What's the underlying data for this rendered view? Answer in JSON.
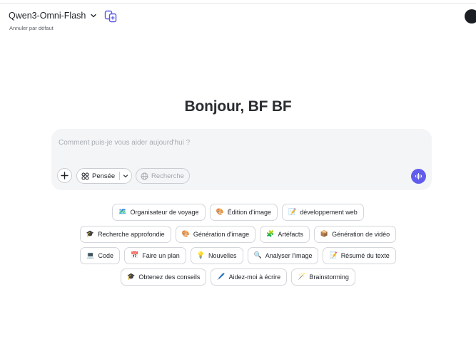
{
  "header": {
    "model_name": "Qwen3-Omni-Flash",
    "reset_label": "Annuler par défaut"
  },
  "greeting": "Bonjour, BF BF",
  "composer": {
    "placeholder": "Comment puis-je vous aider aujourd'hui ?",
    "think_label": "Pensée",
    "search_label": "Recherche"
  },
  "suggestions": {
    "row1": [
      {
        "icon": "🗺️",
        "label": "Organisateur de voyage"
      },
      {
        "icon": "🎨",
        "label": "Édition d'image"
      },
      {
        "icon": "📝",
        "label": "développement web"
      }
    ],
    "row2": [
      {
        "icon": "🎓",
        "label": "Recherche approfondie"
      },
      {
        "icon": "🎨",
        "label": "Génération d'image"
      },
      {
        "icon": "🧩",
        "label": "Artéfacts"
      },
      {
        "icon": "📦",
        "label": "Génération de vidéo"
      }
    ],
    "row3": [
      {
        "icon": "💻",
        "label": "Code"
      },
      {
        "icon": "📅",
        "label": "Faire un plan"
      },
      {
        "icon": "💡",
        "label": "Nouvelles"
      },
      {
        "icon": "🔍",
        "label": "Analyser l'image"
      },
      {
        "icon": "📝",
        "label": "Résumé du texte"
      }
    ],
    "row4": [
      {
        "icon": "🎓",
        "label": "Obtenez des conseils"
      },
      {
        "icon": "🖊️",
        "label": "Aidez-moi à écrire"
      },
      {
        "icon": "🪄",
        "label": "Brainstorming"
      }
    ]
  }
}
